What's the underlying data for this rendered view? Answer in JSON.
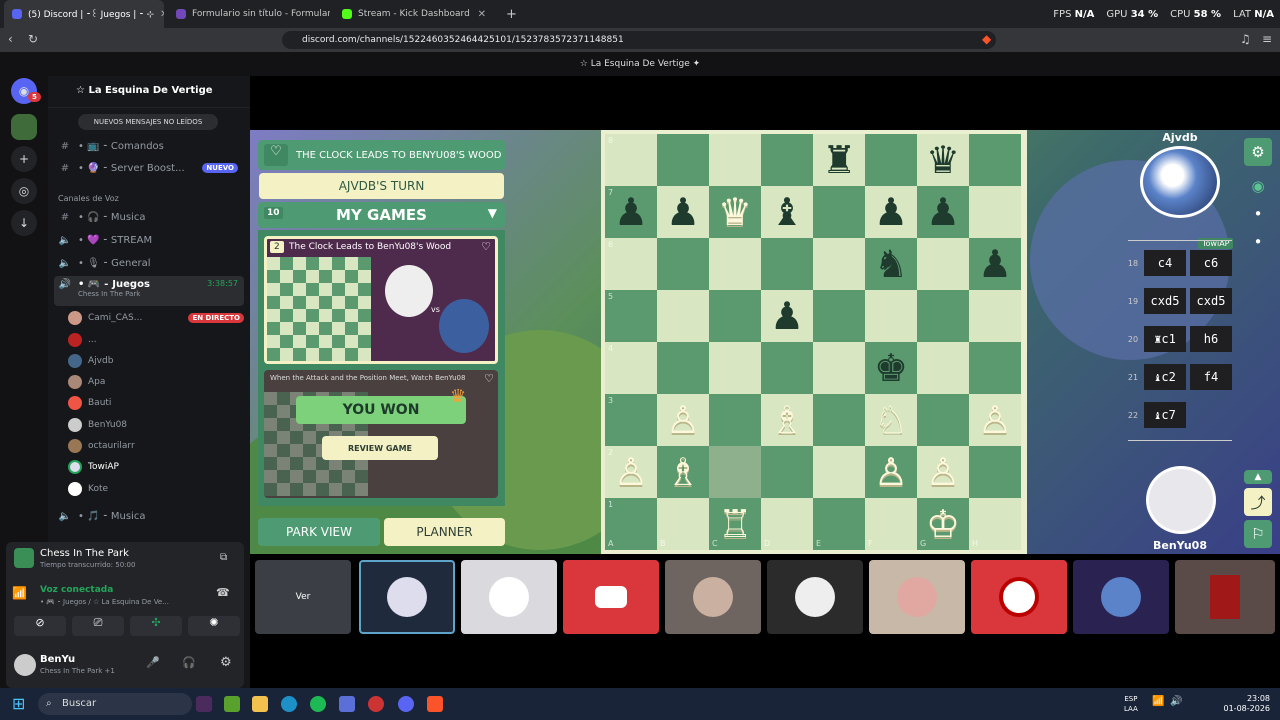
{
  "browser": {
    "tabs": [
      {
        "label": "(5) Discord | ⁃꒰ Juegos | ⁃ ⊹",
        "active": true
      },
      {
        "label": "Formulario sin título - Formularios de",
        "active": false
      },
      {
        "label": "Stream - Kick Dashboard",
        "active": false
      }
    ],
    "new_tab": "+",
    "stats": {
      "fps_label": "FPS",
      "fps": "N/A",
      "gpu_label": "GPU",
      "gpu": "34 %",
      "cpu_label": "CPU",
      "cpu": "58 %",
      "lat_label": "LAT",
      "lat": "N/A"
    },
    "url": "discord.com/channels/1522460352464425101/1523783572371148851"
  },
  "discord": {
    "window_title": "☆ La Esquina De Vertige ✦",
    "server_name": "☆ La Esquina De Vertige",
    "rail_badge": "5",
    "unread_banner": "NUEVOS MENSAJES NO LEÍDOS",
    "channels": [
      {
        "icon": "#",
        "name": "• 📺 ⁃ Comandos"
      },
      {
        "icon": "#",
        "name": "• 🔮 ⁃ Server Boost...",
        "badge": "NUEVO"
      }
    ],
    "voice_category": "Canales de Voz",
    "voice_channels": [
      {
        "icon": "#",
        "name": "• 🎧 ⁃ Musica"
      },
      {
        "icon": "🔈",
        "name": "• 💜 ⁃ STREAM"
      },
      {
        "icon": "🔈",
        "name": "• 🎙 ⁃ General"
      }
    ],
    "active_channel": {
      "name": "• 🎮 ⁃ Juegos",
      "activity": "Chess In The Park",
      "timer": "3:38:57"
    },
    "members": [
      {
        "name": "Cami_CAS...",
        "live": "EN DIRECTO"
      },
      {
        "name": "..."
      },
      {
        "name": "Ajvdb"
      },
      {
        "name": "Apa"
      },
      {
        "name": "Bauti"
      },
      {
        "name": "BenYu08"
      },
      {
        "name": "octaurilarr"
      },
      {
        "name": "TowiAP"
      },
      {
        "name": "Kote"
      }
    ],
    "last_channel": "• 🎵 ⁃ Musica",
    "activity_panel": {
      "title": "Chess In The Park",
      "subtitle": "Tiempo transcurrido: 50:00"
    },
    "voice_panel": {
      "status": "Voz conectada",
      "location": "• 🎮 ⁃ Juegos / ☆ La Esquina De Ve..."
    },
    "user_panel": {
      "name": "BenYu",
      "status": "Chess In The Park +1"
    },
    "tile_watch": "Ver"
  },
  "chess": {
    "clock_banner": "THE CLOCK LEADS TO BENYU08'S WOOD",
    "turn": "AJVDB'S TURN",
    "games_count": "10",
    "my_games": "MY GAMES",
    "game1_num": "2",
    "game1_title": "The Clock Leads to BenYu08's Wood",
    "game2_title": "When the Attack and the Position Meet, Watch BenYu08",
    "you_won": "YOU WON",
    "review": "REVIEW GAME",
    "park_view": "PARK VIEW",
    "planner": "PLANNER",
    "vs": "vs",
    "opponent": "Ajvdb",
    "opponent_tag": "TowiAP",
    "player": "BenYu08",
    "ranks": [
      "8",
      "7",
      "6",
      "5",
      "4",
      "3",
      "2",
      "1"
    ],
    "files": [
      "A",
      "B",
      "C",
      "D",
      "E",
      "F",
      "G",
      "H"
    ],
    "moves": [
      {
        "n": "18",
        "w": "c4",
        "b": "c6"
      },
      {
        "n": "19",
        "w": "cxd5",
        "b": "cxd5"
      },
      {
        "n": "20",
        "w": "♜c1",
        "b": "h6"
      },
      {
        "n": "21",
        "w": "♝c2",
        "b": "f4"
      },
      {
        "n": "22",
        "w": "♝c7",
        "b": ""
      }
    ],
    "pieces": [
      {
        "sq": "e8",
        "p": "♜",
        "c": "b"
      },
      {
        "sq": "g8",
        "p": "♛",
        "c": "b"
      },
      {
        "sq": "a7",
        "p": "♟",
        "c": "b"
      },
      {
        "sq": "b7",
        "p": "♟",
        "c": "b"
      },
      {
        "sq": "c7",
        "p": "♛",
        "c": "w"
      },
      {
        "sq": "d7",
        "p": "♝",
        "c": "b"
      },
      {
        "sq": "f7",
        "p": "♟",
        "c": "b"
      },
      {
        "sq": "g7",
        "p": "♟",
        "c": "b"
      },
      {
        "sq": "f6",
        "p": "♞",
        "c": "b"
      },
      {
        "sq": "h6",
        "p": "♟",
        "c": "b"
      },
      {
        "sq": "d5",
        "p": "♟",
        "c": "b"
      },
      {
        "sq": "f4",
        "p": "♚",
        "c": "b"
      },
      {
        "sq": "b3",
        "p": "♙",
        "c": "w"
      },
      {
        "sq": "d3",
        "p": "♗",
        "c": "w"
      },
      {
        "sq": "f3",
        "p": "♘",
        "c": "w"
      },
      {
        "sq": "h3",
        "p": "♙",
        "c": "w"
      },
      {
        "sq": "a2",
        "p": "♙",
        "c": "w"
      },
      {
        "sq": "b2",
        "p": "♗",
        "c": "w"
      },
      {
        "sq": "f2",
        "p": "♙",
        "c": "w"
      },
      {
        "sq": "g2",
        "p": "♙",
        "c": "w"
      },
      {
        "sq": "c1",
        "p": "♖",
        "c": "w"
      },
      {
        "sq": "g1",
        "p": "♔",
        "c": "w"
      }
    ],
    "highlight": "c2"
  },
  "taskbar": {
    "search": "Buscar",
    "lang": "ESP",
    "lang2": "LAA",
    "time": "23:08",
    "date": "01-08-2026"
  },
  "colors": {
    "light_sq": "#d8e7c1",
    "dark_sq": "#5a9a6e",
    "accent_green": "#4e9b73",
    "accent_cream": "#f4f1c4",
    "live_red": "#da373c"
  }
}
